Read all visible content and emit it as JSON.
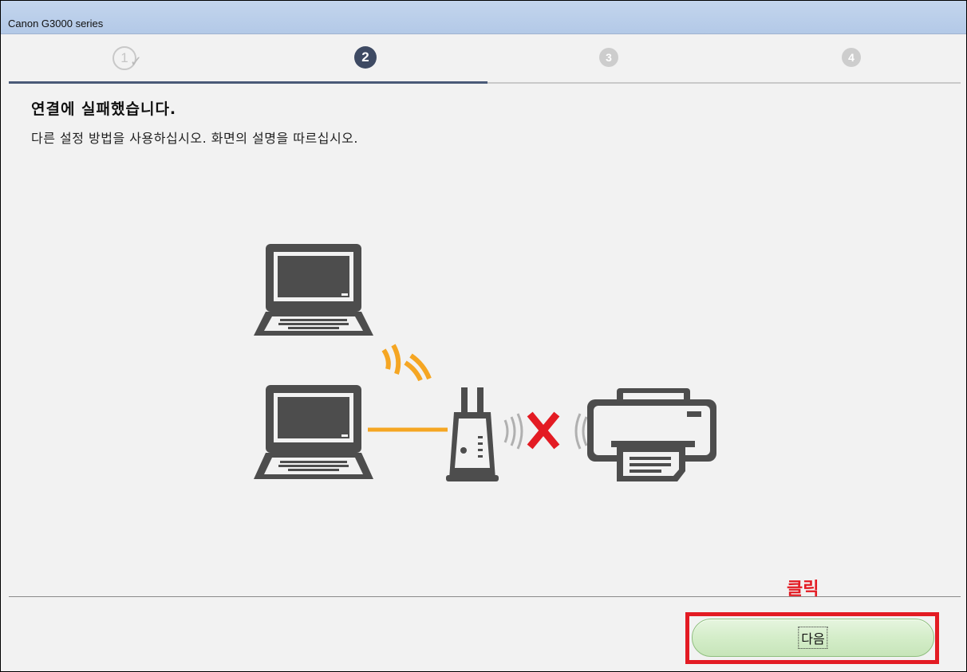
{
  "window": {
    "title": "Canon G3000 series"
  },
  "steps": [
    {
      "label": "1",
      "state": "completed",
      "icon": "check-icon"
    },
    {
      "label": "2",
      "state": "current"
    },
    {
      "label": "3",
      "state": "pending"
    },
    {
      "label": "4",
      "state": "pending"
    }
  ],
  "progress": {
    "current_step": 2,
    "total_steps": 4
  },
  "message": {
    "heading": "연결에 실패했습니다.",
    "instruction": "다른 설정 방법을 사용하십시오. 화면의 설명을 따르십시오."
  },
  "illustration": {
    "icons": [
      "laptop-icon",
      "wifi-signal-icon",
      "laptop-icon",
      "router-icon",
      "connection-failed-icon",
      "printer-icon"
    ],
    "colors": {
      "device": "#4d4d4d",
      "signal": "#f5a623",
      "error": "#e31b23",
      "wave_gray": "#b0b0b0"
    }
  },
  "annotation": {
    "click_label": "클릭"
  },
  "footer": {
    "next_label": "다음"
  },
  "colors": {
    "title_bar": "#b3c9e7",
    "active_step": "#3e4a63",
    "button_green": "#d4edc9",
    "highlight_red": "#e31b23"
  }
}
